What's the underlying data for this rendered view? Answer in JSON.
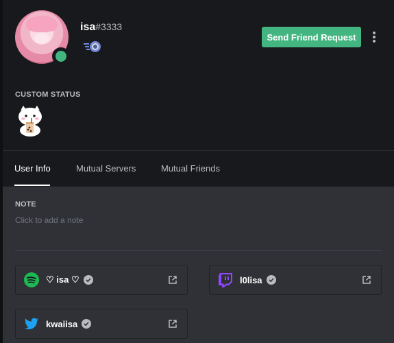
{
  "profile": {
    "username": "isa",
    "discriminator": "#3333",
    "status_color": "#43b581",
    "badge_icon": "hypesquad-badge-icon"
  },
  "actions": {
    "friend_request_label": "Send Friend Request",
    "friend_request_color": "#43b581"
  },
  "custom_status": {
    "label": "CUSTOM STATUS",
    "emoji_icon": "boba-cat-sticker"
  },
  "tabs": [
    {
      "label": "User Info",
      "active": true
    },
    {
      "label": "Mutual Servers",
      "active": false
    },
    {
      "label": "Mutual Friends",
      "active": false
    }
  ],
  "note": {
    "label": "NOTE",
    "placeholder": "Click to add a note"
  },
  "connections": [
    {
      "service": "spotify",
      "icon": "spotify-icon",
      "name": "♡ isa ♡",
      "verified": true
    },
    {
      "service": "twitch",
      "icon": "twitch-icon",
      "name": "l0lisa",
      "verified": true
    },
    {
      "service": "twitter",
      "icon": "twitter-icon",
      "name": "kwaiisa",
      "verified": true
    }
  ]
}
